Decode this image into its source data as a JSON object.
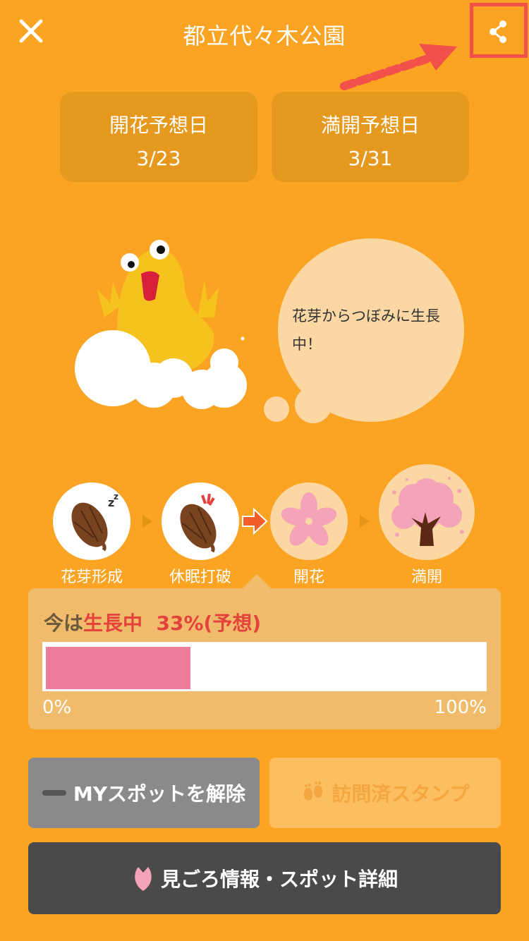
{
  "header": {
    "title": "都立代々木公園"
  },
  "cards": [
    {
      "label": "開花予想日",
      "value": "3/23"
    },
    {
      "label": "満開予想日",
      "value": "3/31"
    }
  ],
  "bubble": {
    "text": "花芽からつぼみに生長中！"
  },
  "stages": [
    {
      "label": "花芽形成"
    },
    {
      "label": "休眠打破"
    },
    {
      "label": "開花"
    },
    {
      "label": "満開"
    }
  ],
  "progress": {
    "prefix": "今は",
    "stage": "生長中",
    "percent_text": "33%(予想)",
    "value_fraction": 0.33,
    "min_label": "0%",
    "max_label": "100%"
  },
  "buttons": {
    "my_spot": "MYスポットを解除",
    "stamp": "訪問済スタンプ",
    "info": "見ごろ情報・スポット詳細"
  },
  "colors": {
    "background": "#FBA423",
    "accent_red": "#E4423C",
    "progress_pink": "#EC7E9B"
  }
}
